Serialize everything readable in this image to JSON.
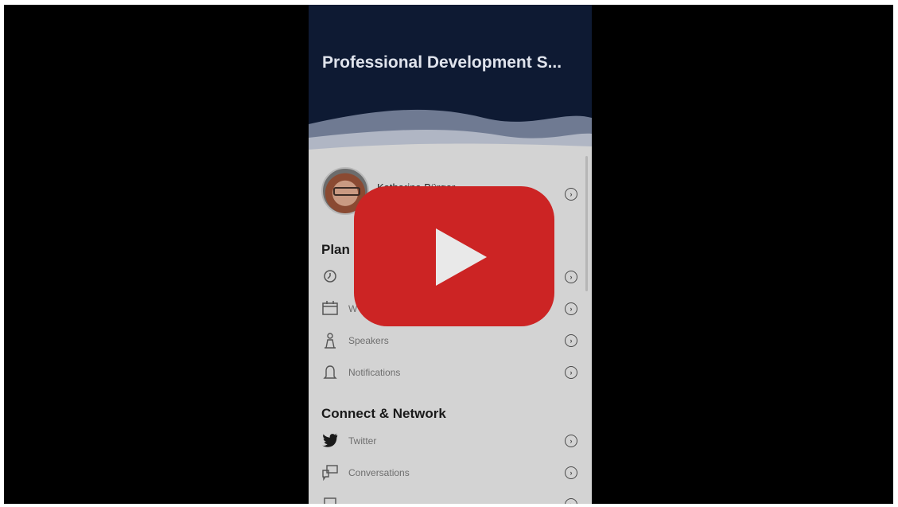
{
  "video": {
    "play_button_label": "Play"
  },
  "app": {
    "status_bar": "",
    "title": "Professional Development S..."
  },
  "profile": {
    "name": "Katharina Bürger"
  },
  "sections": [
    {
      "title": "Plan",
      "items": [
        {
          "label": "",
          "icon": "clock-icon"
        },
        {
          "label": "W",
          "icon": "calendar-icon"
        },
        {
          "label": "Speakers",
          "icon": "speaker-podium-icon"
        },
        {
          "label": "Notifications",
          "icon": "bell-icon"
        }
      ]
    },
    {
      "title": "Connect & Network",
      "items": [
        {
          "label": "Twitter",
          "icon": "twitter-icon"
        },
        {
          "label": "Conversations",
          "icon": "conversations-icon"
        },
        {
          "label": "",
          "icon": "square-icon"
        }
      ]
    }
  ],
  "colors": {
    "header_bg": "#0e1a33",
    "content_bg": "#d3d3d3",
    "play_red": "#cc2424"
  }
}
